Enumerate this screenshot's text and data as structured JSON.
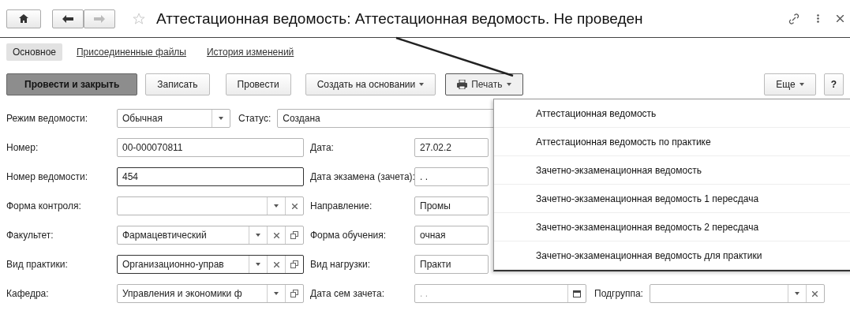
{
  "nav": {
    "buttons": [
      {
        "kind": "home",
        "disabled": false
      },
      {
        "kind": "back",
        "disabled": false
      },
      {
        "kind": "forward",
        "disabled": true
      }
    ]
  },
  "title": "Аттестационная ведомость: Аттестационная ведомость. Не проведен",
  "tabs": [
    {
      "label": "Основное",
      "selected": true
    },
    {
      "label": "Присоединенные файлы",
      "selected": false
    },
    {
      "label": "История изменений",
      "selected": false
    }
  ],
  "toolbar": {
    "buttons": [
      {
        "label": "Провести и закрыть",
        "kind": "primary"
      },
      {
        "label": "Записать",
        "kind": "plain"
      },
      {
        "label": "Провести",
        "kind": "plain"
      },
      {
        "label": "Создать на основании",
        "kind": "menu"
      },
      {
        "label": "Печать",
        "kind": "print"
      }
    ],
    "right_buttons": [
      {
        "label": "Еще",
        "kind": "menu"
      },
      {
        "label": "?",
        "kind": "plain"
      }
    ]
  },
  "form_rows": [
    {
      "kind": "compact",
      "left": {
        "label": "Режим ведомости:",
        "value": "Обычная",
        "focused": false,
        "dropdown": true
      },
      "right": {
        "label": "Статус:",
        "value": "Создана",
        "focused": false
      }
    },
    {
      "kind": "standard",
      "left": {
        "label": "Номер:",
        "value": "00-000070811",
        "focused": false
      },
      "right": {
        "label": "Дата:",
        "value": "27.02.2",
        "focused": false
      }
    },
    {
      "kind": "standard",
      "left": {
        "label": "Номер ведомости:",
        "value": "454",
        "focused": true
      },
      "right": {
        "label": "Дата экзамена (зачета):",
        "value": ". .",
        "focused": false
      }
    },
    {
      "kind": "standard",
      "left": {
        "label": "Форма контроля:",
        "focused": false,
        "dropdown": true,
        "clear": true
      },
      "right": {
        "label": "Направление:",
        "value": "Промы",
        "focused": false
      }
    },
    {
      "kind": "standard",
      "left": {
        "label": "Факультет:",
        "value": "Фармацевтический",
        "focused": false,
        "dropdown": true,
        "clear": true,
        "open": true
      },
      "right": {
        "label": "Форма обучения:",
        "value": "очная",
        "focused": false
      }
    },
    {
      "kind": "standard",
      "left": {
        "label": "Вид практики:",
        "value": "Организационно-управ",
        "focused": true,
        "dropdown": true,
        "clear": true,
        "open": true
      },
      "right": {
        "label": "Вид нагрузки:",
        "value": "Практи",
        "focused": false
      }
    },
    {
      "kind": "triple",
      "left": {
        "label": "Кафедра:",
        "value": "Управления и экономики ф",
        "focused": false,
        "dropdown": true,
        "open": true
      },
      "right": {
        "label": "Дата сем зачета:",
        "placeholder": ". .",
        "focused": false,
        "calendar": true
      },
      "extra": {
        "label": "Подгруппа:",
        "focused": false,
        "dropdown": true,
        "clear": true
      }
    }
  ],
  "print_menu": {
    "items": [
      "Аттестационная ведомость",
      "Аттестационная ведомость по практике",
      "Зачетно-экзаменационная ведомость",
      "Зачетно-экзаменационная ведомость 1 пересдача",
      "Зачетно-экзаменационная ведомость 2 пересдача",
      "Зачетно-экзаменационная ведомость для практики"
    ]
  }
}
